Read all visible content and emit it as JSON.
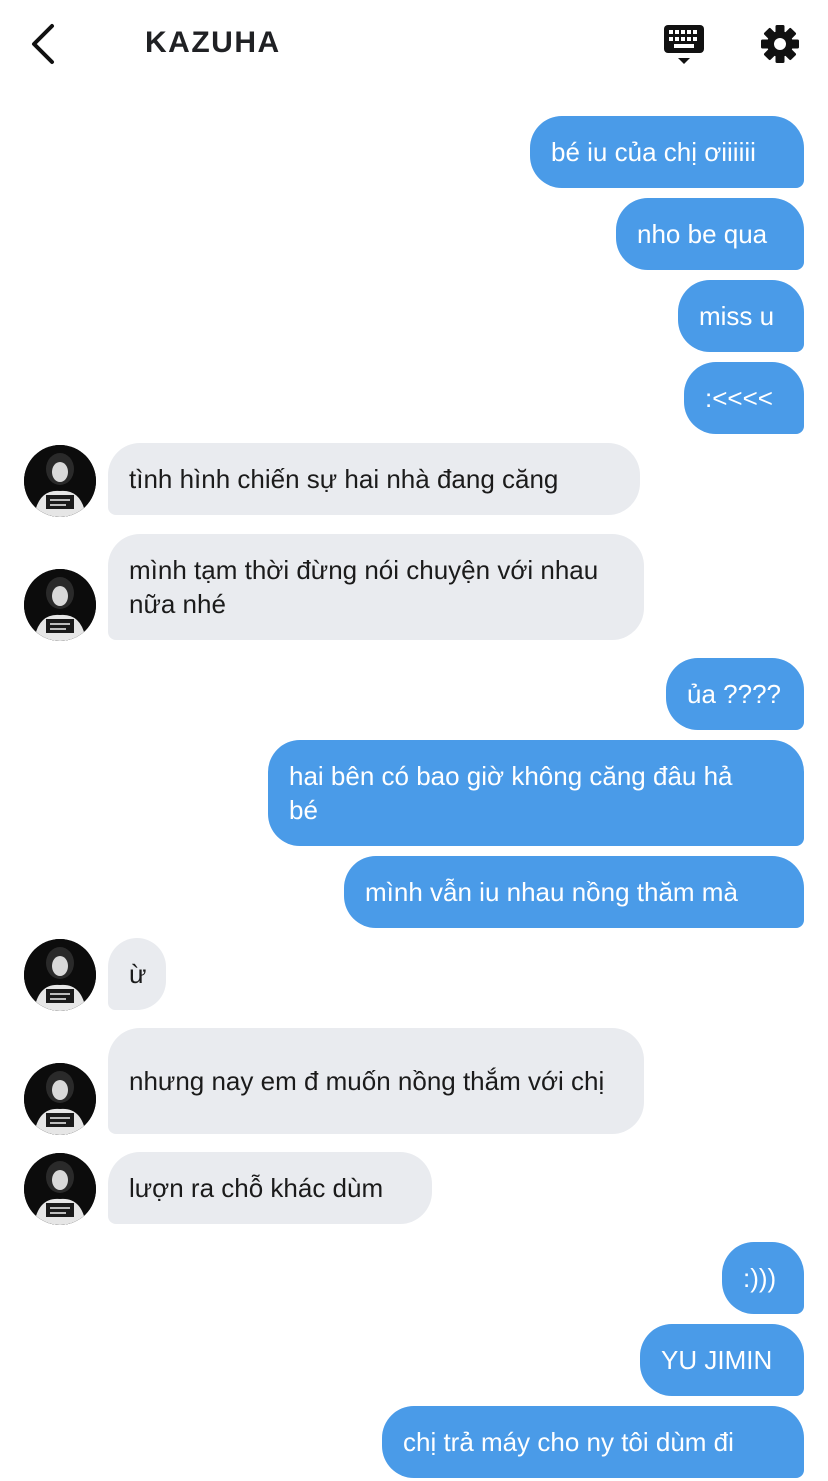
{
  "header": {
    "title": "KAZUHA",
    "back_icon": "chevron-left-icon",
    "keyboard_icon": "keyboard-icon",
    "settings_icon": "gear-icon"
  },
  "colors": {
    "sent_bubble": "#4a9be8",
    "received_bubble": "#e9ebef"
  },
  "messages": [
    {
      "from": "me",
      "text": "bé iu của chị ơiiiiii"
    },
    {
      "from": "me",
      "text": "nho be qua"
    },
    {
      "from": "me",
      "text": "miss u"
    },
    {
      "from": "me",
      "text": ":<<<<"
    },
    {
      "from": "them",
      "text": "tình hình chiến sự hai nhà đang căng"
    },
    {
      "from": "them",
      "text": "mình tạm thời đừng nói chuyện với nhau nữa nhé"
    },
    {
      "from": "me",
      "text": "ủa ????"
    },
    {
      "from": "me",
      "text": "hai bên có bao giờ không căng đâu hả bé"
    },
    {
      "from": "me",
      "text": "mình vẫn iu nhau nồng thăm mà"
    },
    {
      "from": "them",
      "text": "ừ"
    },
    {
      "from": "them",
      "text": "nhưng nay em đ muốn nồng thắm với chị"
    },
    {
      "from": "them",
      "text": "lượn ra chỗ khác dùm"
    },
    {
      "from": "me",
      "text": ":)))"
    },
    {
      "from": "me",
      "text": "YU JIMIN"
    },
    {
      "from": "me",
      "text": "chị trả máy cho ny tôi dùm đi"
    }
  ]
}
